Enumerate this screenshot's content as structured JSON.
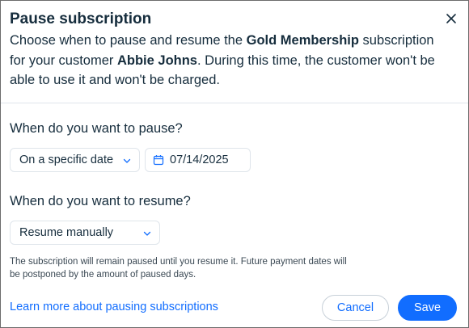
{
  "dialog": {
    "title": "Pause subscription",
    "description": {
      "part1": "Choose when to pause and resume the ",
      "plan_name": "Gold Membership",
      "part2": " subscription for your customer ",
      "customer_name": "Abbie Johns",
      "part3": ". During this time, the customer won't be able to use it and won't be charged."
    },
    "close_icon": "close-icon"
  },
  "pause": {
    "label": "When do you want to pause?",
    "option_selected": "On a specific date",
    "date_value": "07/14/2025",
    "date_icon": "calendar-icon"
  },
  "resume": {
    "label": "When do you want to resume?",
    "option_selected": "Resume manually",
    "helper_text": "The subscription will remain paused until you resume it. Future payment dates will be postponed by the amount of paused days."
  },
  "footer": {
    "learn_more_link": "Learn more about pausing subscriptions",
    "cancel_label": "Cancel",
    "save_label": "Save"
  },
  "colors": {
    "accent": "#116dff",
    "text": "#162d3d",
    "border": "#dfe5eb"
  }
}
